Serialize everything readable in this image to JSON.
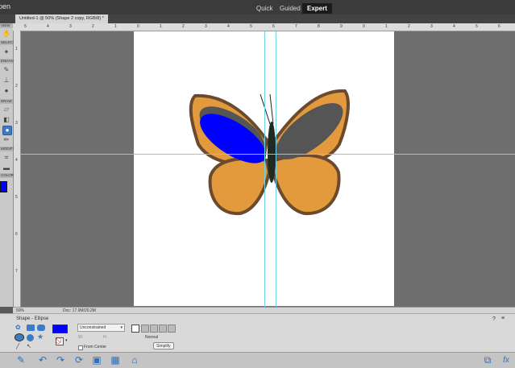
{
  "topbar": {
    "open_label": "pen",
    "modes": [
      "Quick",
      "Guided",
      "Expert"
    ],
    "active_mode": "Expert"
  },
  "document": {
    "tab_title": "Untitled-1 @ 50% (Shape 2 copy, RGB/8) *"
  },
  "toolbox": {
    "sections": [
      "VIEW",
      "SELECT",
      "ENHANCE",
      "DRAW",
      "MODIFY",
      "COLOR"
    ],
    "foreground_color": "#0000ff"
  },
  "rulers": {
    "top_ticks": [
      "5",
      "4",
      "3",
      "2",
      "1",
      "0",
      "1",
      "2",
      "3",
      "4",
      "5",
      "6",
      "7",
      "8",
      "9",
      "0",
      "1",
      "2",
      "3",
      "4",
      "5",
      "6"
    ],
    "left_ticks": [
      "1",
      "2",
      "3",
      "4",
      "5",
      "6",
      "7"
    ]
  },
  "status": {
    "zoom": "50%",
    "doc_info": "Doc: 17.9M/20.2M"
  },
  "options": {
    "tool_name": "Shape - Ellipse",
    "fill_color": "#0000ff",
    "constraint": "Unconstrained",
    "w_label": "W:",
    "h_label": "H:",
    "from_center": "From Center",
    "mode": "Normal",
    "simplify": "Simplify"
  },
  "artwork": {
    "ellipse_left_color": "#0000ff",
    "ellipse_right_color": "#555555",
    "wing_color": "#e39a3d",
    "wing_edge_color": "#6b4a2e"
  }
}
